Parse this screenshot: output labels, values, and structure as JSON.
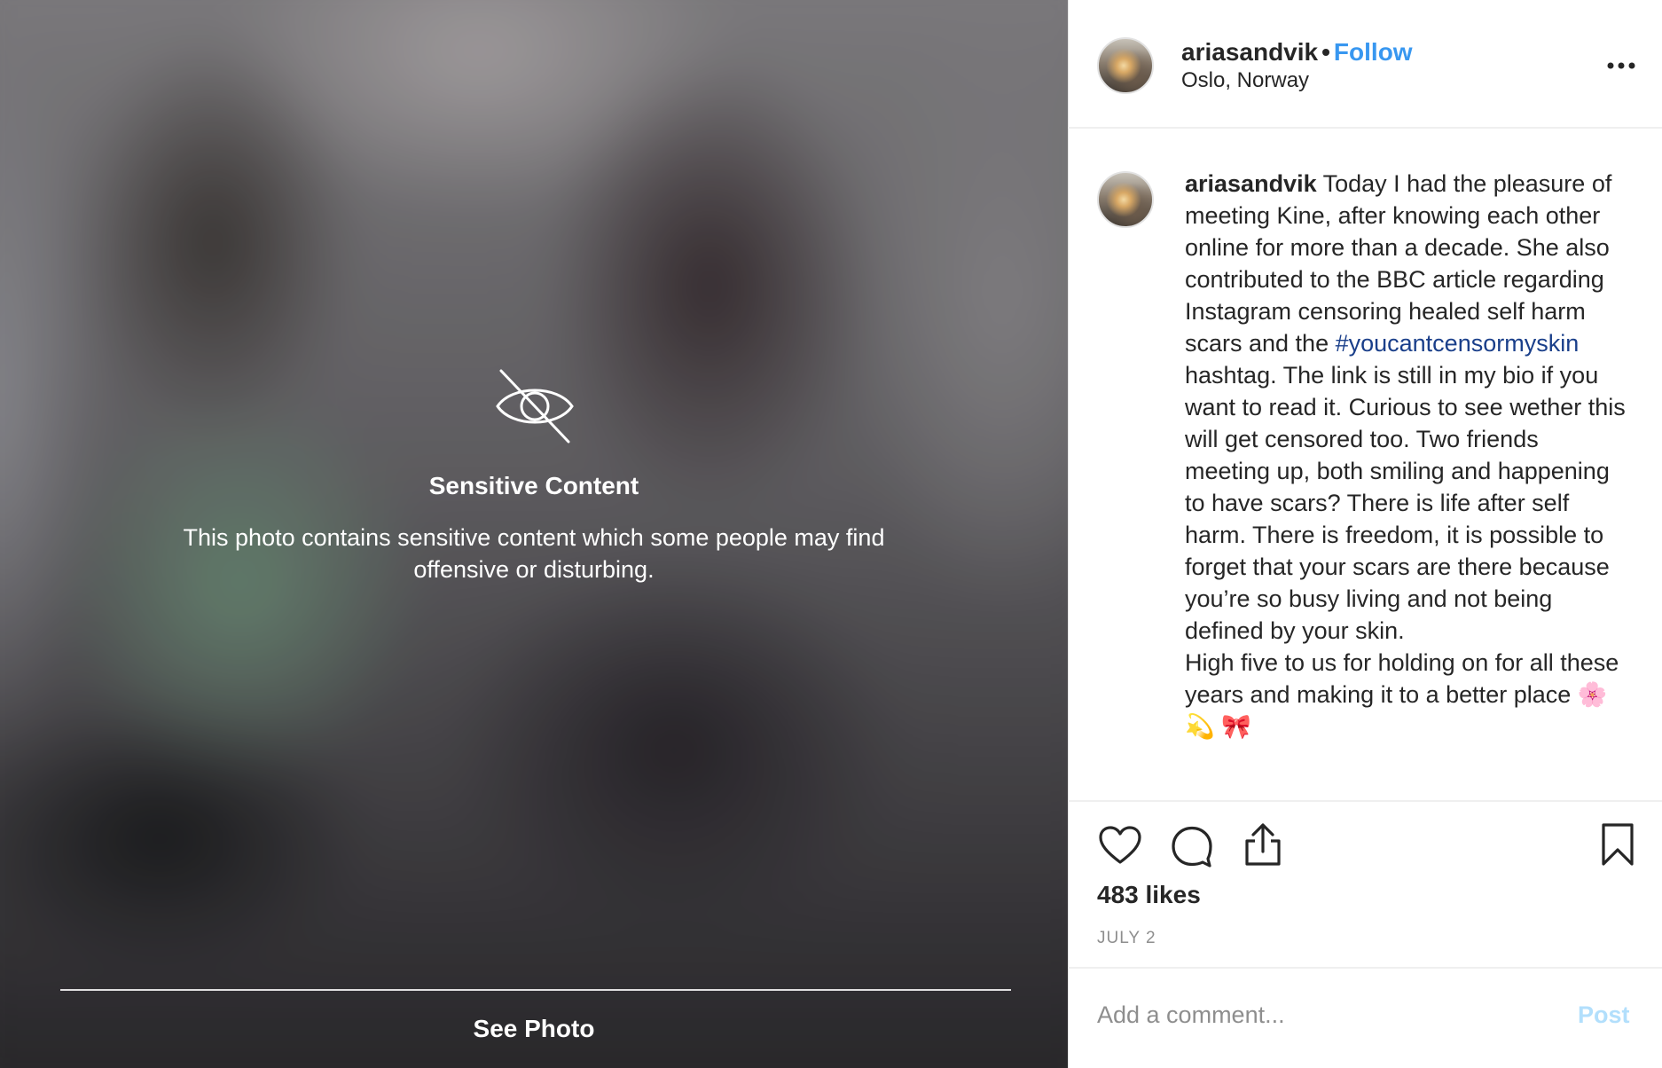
{
  "media": {
    "overlay_icon": "eye-slash-icon",
    "title": "Sensitive Content",
    "description": "This photo contains sensitive content which some people may find offensive or disturbing.",
    "see_photo_label": "See Photo"
  },
  "header": {
    "username": "ariasandvik",
    "separator": "•",
    "follow_label": "Follow",
    "location": "Oslo, Norway",
    "more_icon": "more-options-icon"
  },
  "caption": {
    "username": "ariasandvik",
    "text_before_hashtag": " Today I had the pleasure of meeting Kine, after knowing each other online for more than a decade. She also contributed to the BBC article regarding Instagram censoring healed self harm scars and the ",
    "hashtag": "#youcantcensormyskin",
    "text_after_hashtag": " hashtag. The link is still in my bio if you want to read it. Curious to see wether this will get censored too. Two friends meeting up, both smiling and happening to have scars? There is life after self harm. There is freedom, it is possible to forget that your scars are there because you’re so busy living and not being defined by your skin.\nHigh five to us for holding on for all these years and making it to a better place 🌸 💫 🎀"
  },
  "actions": {
    "icons": [
      "heart-icon",
      "comment-icon",
      "share-icon",
      "bookmark-icon"
    ],
    "likes": "483 likes",
    "date": "JULY 2"
  },
  "comment_box": {
    "placeholder": "Add a comment...",
    "post_label": "Post"
  },
  "colors": {
    "link_blue": "#3897f0",
    "hashtag_blue": "#1a3f8a",
    "post_disabled": "#b2dffc",
    "text": "#262626",
    "muted": "#8e8e8e"
  }
}
